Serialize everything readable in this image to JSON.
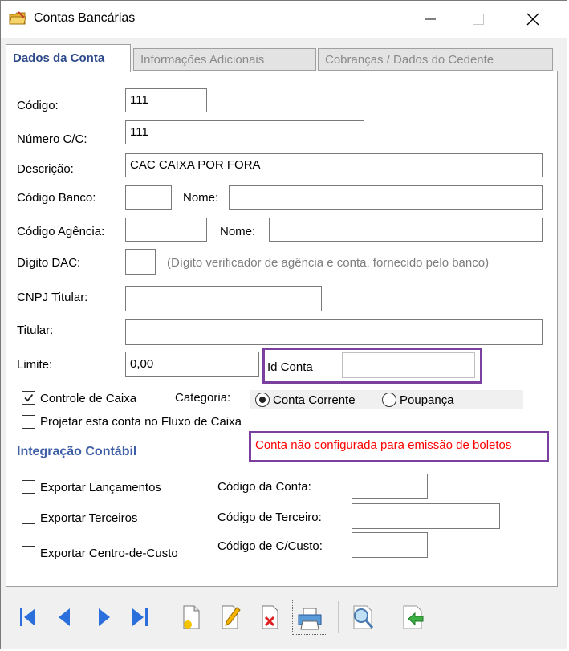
{
  "window": {
    "title": "Contas Bancárias"
  },
  "tabs": [
    {
      "label": "Dados da Conta",
      "active": true
    },
    {
      "label": "Informações Adicionais",
      "active": false
    },
    {
      "label": "Cobranças / Dados do Cedente",
      "active": false
    }
  ],
  "form": {
    "codigo": {
      "label": "Código:",
      "value": "111"
    },
    "numero_cc": {
      "label": "Número C/C:",
      "value": "111"
    },
    "descricao": {
      "label": "Descrição:",
      "value": "CAC CAIXA POR FORA"
    },
    "codigo_banco": {
      "label": "Código Banco:",
      "value": ""
    },
    "nome_banco": {
      "label": "Nome:",
      "value": ""
    },
    "codigo_agencia": {
      "label": "Código Agência:",
      "value": ""
    },
    "nome_agencia": {
      "label": "Nome:",
      "value": ""
    },
    "digito_dac": {
      "label": "Dígito DAC:",
      "value": "",
      "hint": "(Dígito verificador de agência e conta, fornecido pelo banco)"
    },
    "cnpj_titular": {
      "label": "CNPJ Titular:",
      "value": ""
    },
    "titular": {
      "label": "Titular:",
      "value": ""
    },
    "limite": {
      "label": "Limite:",
      "value": "0,00"
    },
    "id_conta": {
      "label": "Id Conta",
      "value": ""
    },
    "controle_caixa": {
      "label": "Controle de Caixa",
      "checked": true
    },
    "categoria": {
      "label": "Categoria:",
      "options": [
        "Conta Corrente",
        "Poupança"
      ],
      "selected": "Conta Corrente"
    },
    "projetar_fluxo": {
      "label": "Projetar esta conta no Fluxo de Caixa",
      "checked": false
    },
    "warning": "Conta não configurada para emissão de boletos"
  },
  "integracao": {
    "title": "Integração Contábil",
    "exportar_lancamentos": {
      "label": "Exportar Lançamentos",
      "checked": false
    },
    "exportar_terceiros": {
      "label": "Exportar Terceiros",
      "checked": false
    },
    "exportar_centro_custo": {
      "label": "Exportar Centro-de-Custo",
      "checked": false
    },
    "codigo_conta": {
      "label": "Código da Conta:",
      "value": ""
    },
    "codigo_terceiro": {
      "label": "Código de Terceiro:",
      "value": ""
    },
    "codigo_ccusto": {
      "label": "Código de C/Custo:",
      "value": ""
    }
  },
  "colors": {
    "tab_active": "#2e4a8c",
    "section": "#3f5fa8",
    "highlight": "#7b3f9e",
    "warning": "#ff0000",
    "nav": "#2a6fdc"
  }
}
